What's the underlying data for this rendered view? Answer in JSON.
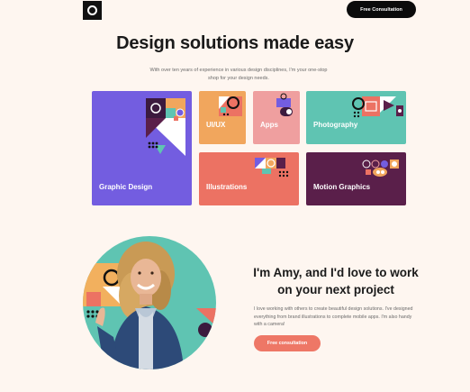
{
  "header": {
    "cta_label": "Free Consultation",
    "logo": "ring-logo-icon"
  },
  "hero": {
    "title": "Design solutions made easy",
    "subtitle": "With over ten years of experience in various design disciplines, I'm your one-stop shop for your design needs."
  },
  "services": [
    {
      "label": "Graphic Design",
      "color": "#735de0"
    },
    {
      "label": "UI/UX",
      "color": "#f1a65d"
    },
    {
      "label": "Apps",
      "color": "#ef9f9f"
    },
    {
      "label": "Photography",
      "color": "#5fc4b2"
    },
    {
      "label": "Illustrations",
      "color": "#ec7263"
    },
    {
      "label": "Motion Graphics",
      "color": "#5a1f4a"
    }
  ],
  "about": {
    "title": "I'm Amy, and I'd love to work on your next project",
    "text": "I love working with others to create beautiful design solutions. I've designed everything from brand illustrations to complete mobile apps. I'm also handy with a camera!",
    "cta_label": "Free consultation",
    "portrait_icon": "person-portrait-icon"
  },
  "colors": {
    "background": "#fef6f0",
    "dark": "#0b0b0b",
    "accent": "#ee7766",
    "teal": "#5fc4b2"
  }
}
